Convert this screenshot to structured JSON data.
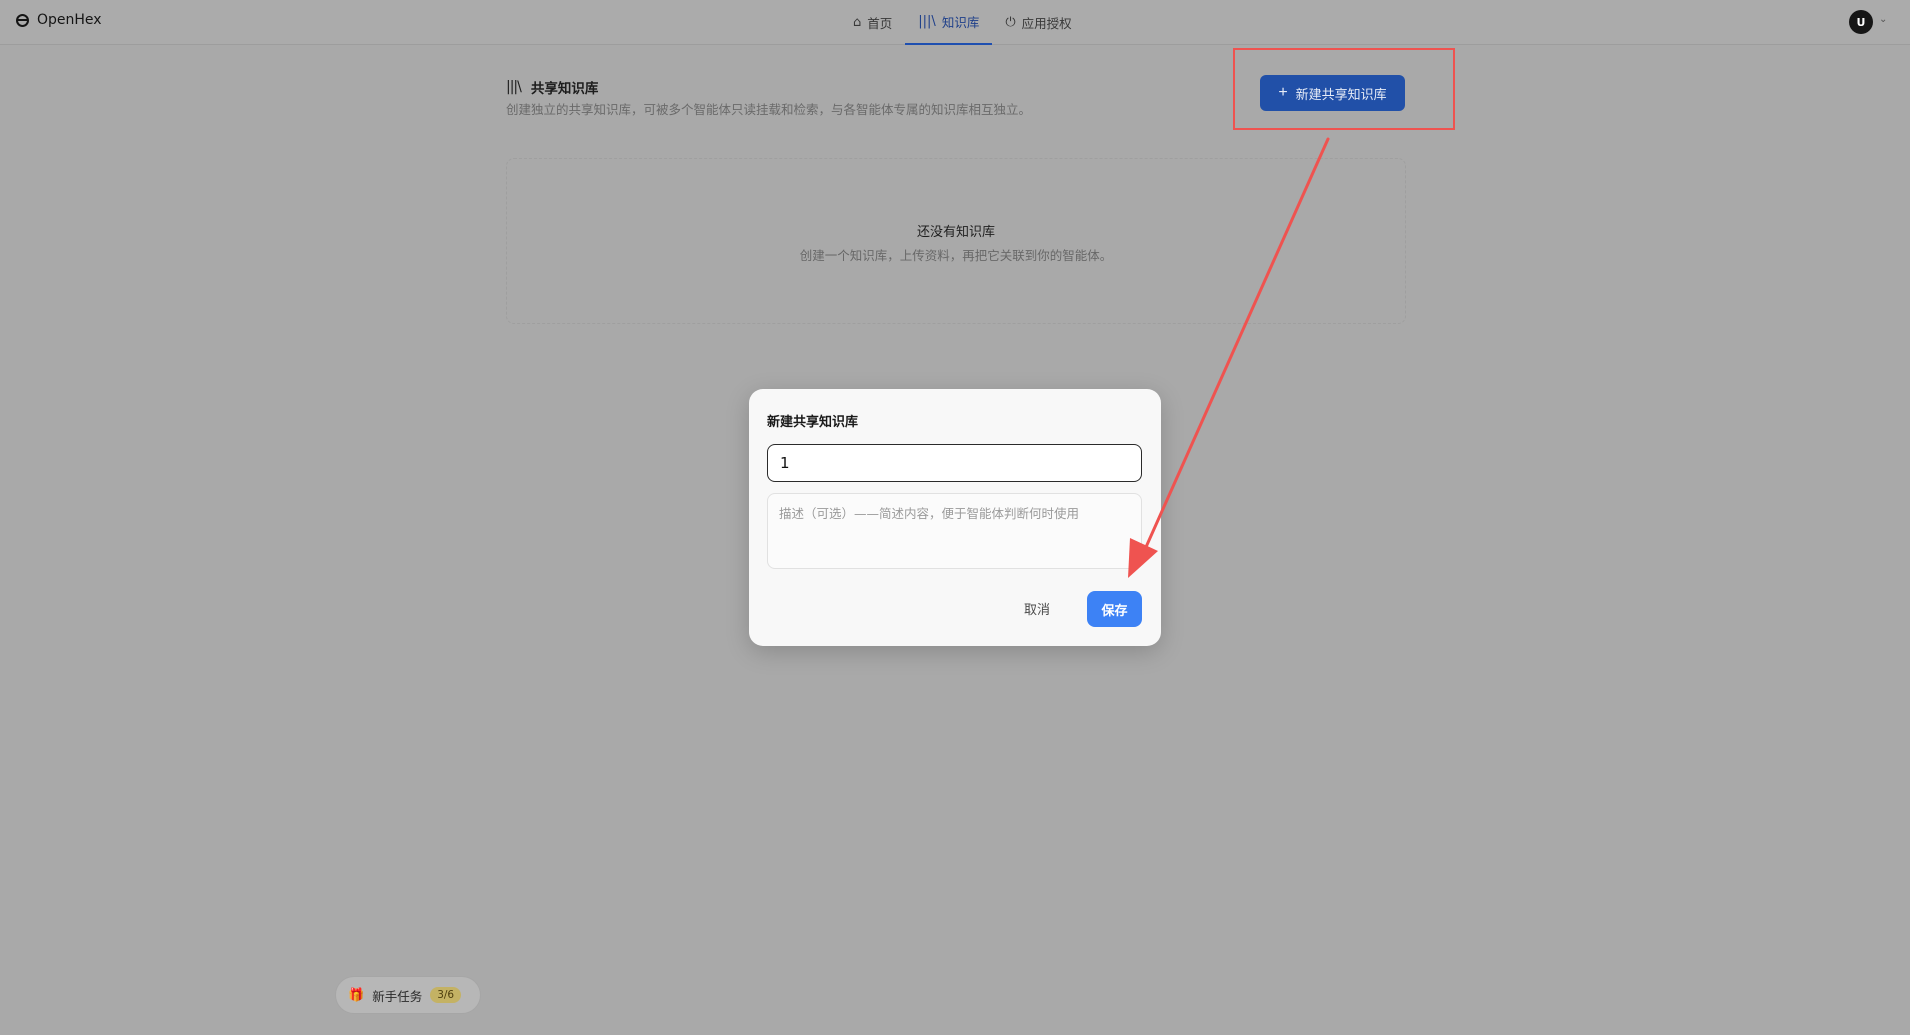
{
  "app": {
    "name": "OpenHex"
  },
  "nav": {
    "tabs": [
      {
        "label": "首页",
        "icon": "home-icon",
        "active": false
      },
      {
        "label": "知识库",
        "icon": "library-icon",
        "active": true
      },
      {
        "label": "应用授权",
        "icon": "plug-icon",
        "active": false
      }
    ]
  },
  "user": {
    "avatar_initial": "U"
  },
  "page": {
    "title": "共享知识库",
    "description": "创建独立的共享知识库，可被多个智能体只读挂载和检索，与各智能体专属的知识库相互独立。",
    "new_button_label": "新建共享知识库",
    "empty_state": {
      "title": "还没有知识库",
      "subtitle": "创建一个知识库，上传资料，再把它关联到你的智能体。"
    }
  },
  "modal": {
    "title": "新建共享知识库",
    "name_value": "1",
    "description_placeholder": "描述（可选）——简述内容，便于智能体判断何时使用",
    "cancel_label": "取消",
    "save_label": "保存"
  },
  "onboarding": {
    "label": "新手任务",
    "progress": "3/6"
  },
  "colors": {
    "primary": "#3d82f5",
    "annotation": "#ef5350",
    "active_tab": "#1e3f8a"
  }
}
